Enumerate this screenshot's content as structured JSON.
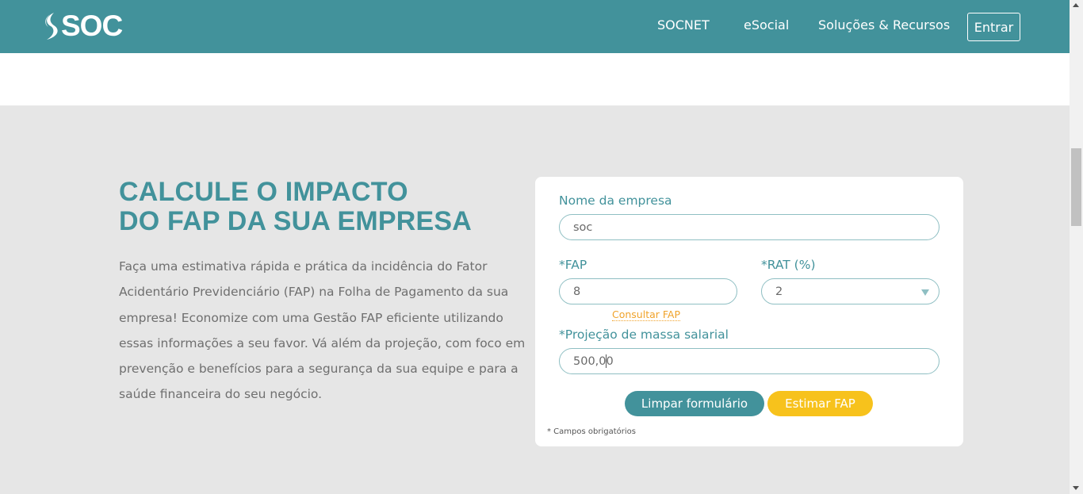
{
  "nav": {
    "logo_text": "SOC",
    "links": [
      "SOCNET",
      "eSocial",
      "Soluções & Recursos"
    ],
    "login_label": "Entrar"
  },
  "hero": {
    "title_line1": "CALCULE O IMPACTO",
    "title_line2": "DO FAP DA SUA EMPRESA",
    "description": "Faça uma estimativa rápida e prática da incidência do Fator Acidentário Previdenciário (FAP) na Folha de Pagamento da sua empresa! Economize com uma Gestão FAP eficiente utilizando essas informações a seu favor. Vá além da projeção, com foco em prevenção e benefícios para a segurança da sua equipe e para a saúde financeira do seu negócio."
  },
  "form": {
    "company": {
      "label": "Nome da empresa",
      "value": "soc"
    },
    "fap": {
      "label": "*FAP",
      "value": "8",
      "link": "Consultar FAP"
    },
    "rat": {
      "label": "*RAT (%)",
      "value": "2"
    },
    "payroll": {
      "label": "*Projeção de massa salarial",
      "value_before_cursor": "500,0",
      "value_after_cursor": "0"
    },
    "clear_button": "Limpar formulário",
    "estimate_button": "Estimar FAP",
    "required_note": "* Campos obrigatórios"
  },
  "colors": {
    "brand_teal": "#42929b",
    "accent_yellow": "#f7c21c",
    "link_orange": "#f0a32b",
    "section_gray": "#e6e6e6"
  }
}
